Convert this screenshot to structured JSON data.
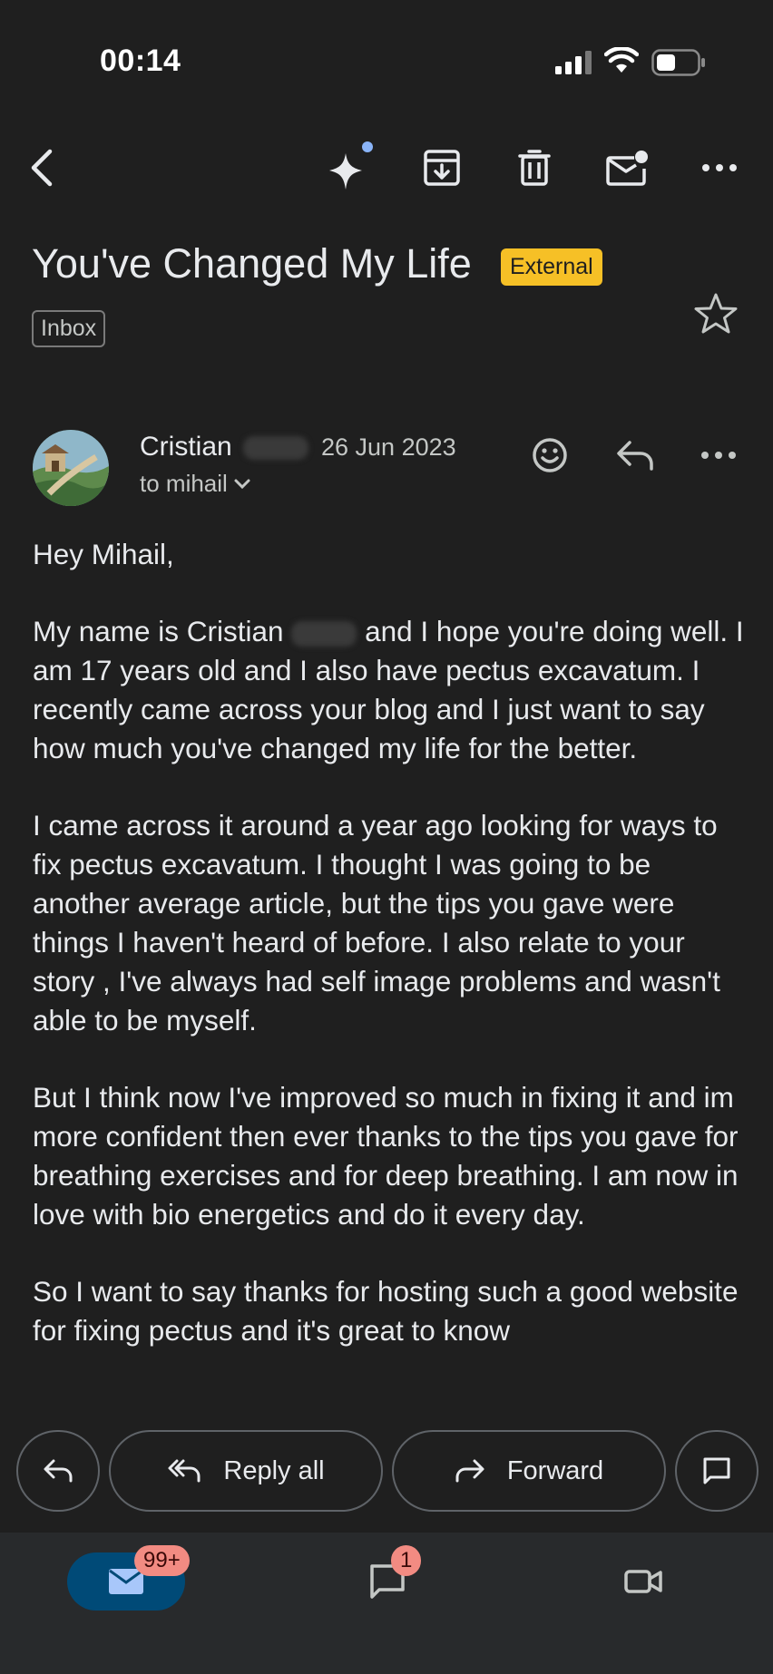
{
  "status_bar": {
    "time": "00:14"
  },
  "toolbar": {
    "icons": [
      "back-icon",
      "sparkle-icon",
      "archive-icon",
      "delete-icon",
      "mark-unread-icon",
      "more-icon"
    ]
  },
  "email": {
    "subject": "You've Changed My Life",
    "external_badge": "External",
    "label_chip": "Inbox",
    "sender_name": "Cristian",
    "date": "26 Jun 2023",
    "to_line": "to mihail",
    "body": {
      "greeting": "Hey Mihail,",
      "p1_before": "My name is Cristian",
      "p1_after": "and I hope you're doing well. I am 17 years old and I also have pectus excavatum. I recently came across your blog and I just want to say how much you've changed my life for the better.",
      "p2": "I came across it around a year ago looking for ways to fix pectus excavatum. I thought I was going to be another average article, but the tips you gave were things I haven't heard of before. I also relate to your story , I've always had self image problems and wasn't able to be myself.",
      "p3": "But I think now I've improved so much in fixing it and im more confident then ever thanks to the tips you gave for breathing exercises and for deep breathing. I am now in love with bio energetics and do it every day.",
      "p4": "So I want to say thanks for hosting such a good website for fixing pectus and it's great to know"
    }
  },
  "actions": {
    "reply_all": "Reply all",
    "forward": "Forward"
  },
  "bottom_nav": {
    "mail_badge": "99+",
    "chat_badge": "1"
  },
  "colors": {
    "background": "#1f1f1f",
    "external_badge": "#f6c026",
    "nav_active": "#004a77",
    "badge": "#f28b82"
  }
}
